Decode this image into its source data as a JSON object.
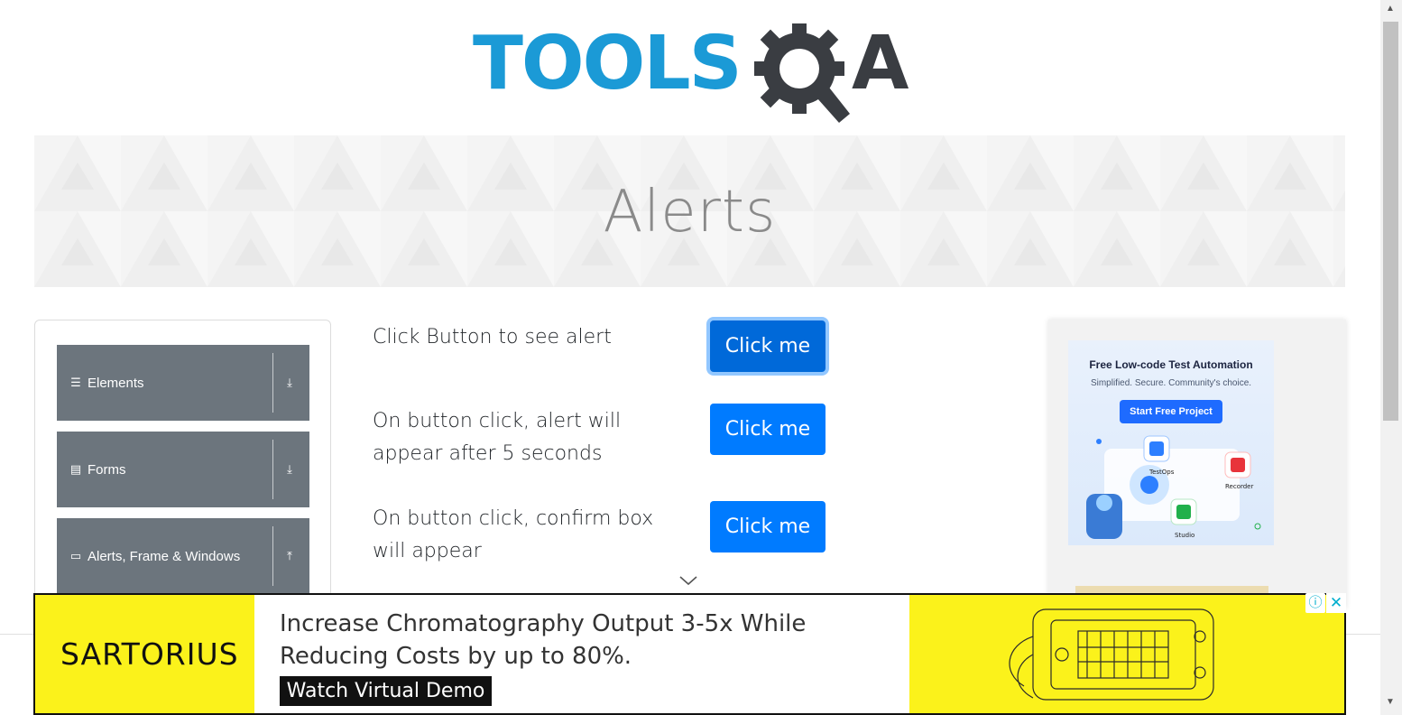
{
  "header": {
    "logo_primary": "TOOLS",
    "logo_secondary": "A"
  },
  "banner": {
    "title": "Alerts"
  },
  "sidebar": {
    "groups": [
      {
        "label": "Elements",
        "icon": "hamburger-icon",
        "chevron": "download-icon"
      },
      {
        "label": "Forms",
        "icon": "form-icon",
        "chevron": "download-icon"
      },
      {
        "label": "Alerts, Frame & Windows",
        "icon": "window-icon",
        "chevron": "upload-icon"
      }
    ]
  },
  "main": {
    "rows": [
      {
        "text_line1": "Click Button to see alert",
        "text_line2": "",
        "button": "Click me",
        "focused": true
      },
      {
        "text_line1": "On button click, alert will",
        "text_line2": "appear after 5 seconds",
        "button": "Click me",
        "focused": false
      },
      {
        "text_line1": "On button click, confirm box",
        "text_line2": "will appear",
        "button": "Click me",
        "focused": false
      }
    ]
  },
  "right_ad": {
    "title": "Free Low-code Test Automation",
    "subtitle": "Simplified. Secure. Community's choice.",
    "cta": "Start Free Project",
    "labels": [
      "TestOps",
      "Recorder",
      "Studio"
    ]
  },
  "bottom_ad": {
    "brand": "SARTORIUS",
    "headline_line1": "Increase Chromatography Output 3-5x While",
    "headline_line2": "Reducing Costs by up to 80%.",
    "cta": "Watch Virtual Demo",
    "info": "ⓘ",
    "close": "✕"
  },
  "colors": {
    "primary_button": "#007bff",
    "sidebar_group": "#6c757d",
    "logo_blue": "#1b9ad6",
    "logo_dark": "#3a3d42",
    "ad_yellow": "#fbf21b"
  }
}
